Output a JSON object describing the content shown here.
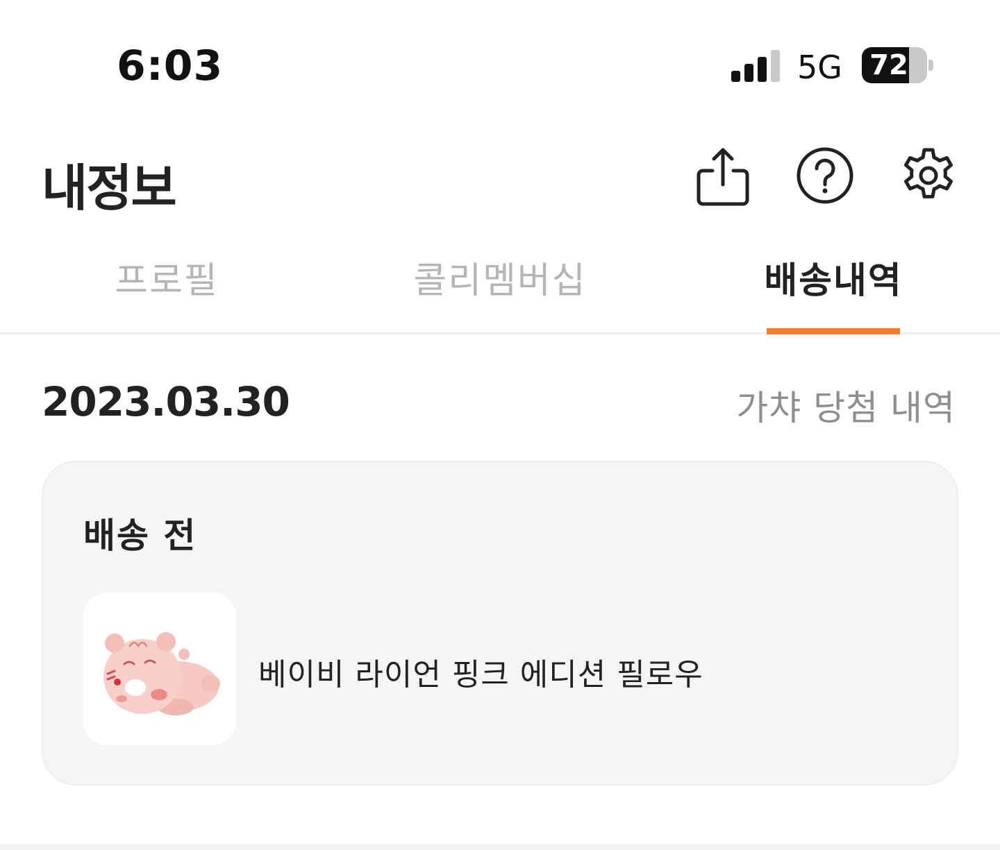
{
  "status_bar": {
    "time": "6:03",
    "network": "5G",
    "battery_percent": "72",
    "battery_level": 0.72,
    "signal_bars_active": 3,
    "signal_bars_total": 4
  },
  "header": {
    "title": "내정보",
    "icons": [
      "share-icon",
      "help-icon",
      "settings-icon"
    ]
  },
  "tabs": [
    {
      "label": "프로필",
      "active": false
    },
    {
      "label": "콜리멤버십",
      "active": false
    },
    {
      "label": "배송내역",
      "active": true
    }
  ],
  "shipping": {
    "date": "2023.03.30",
    "gacha_link": "가챠 당첨 내역",
    "status": "배송 전",
    "product_name": "베이비 라이언 핑크 에디션 필로우"
  },
  "colors": {
    "accent": "#ff7a29",
    "text_primary": "#222222",
    "text_inactive": "#b5b5b5",
    "card_bg": "#f5f5f5"
  }
}
